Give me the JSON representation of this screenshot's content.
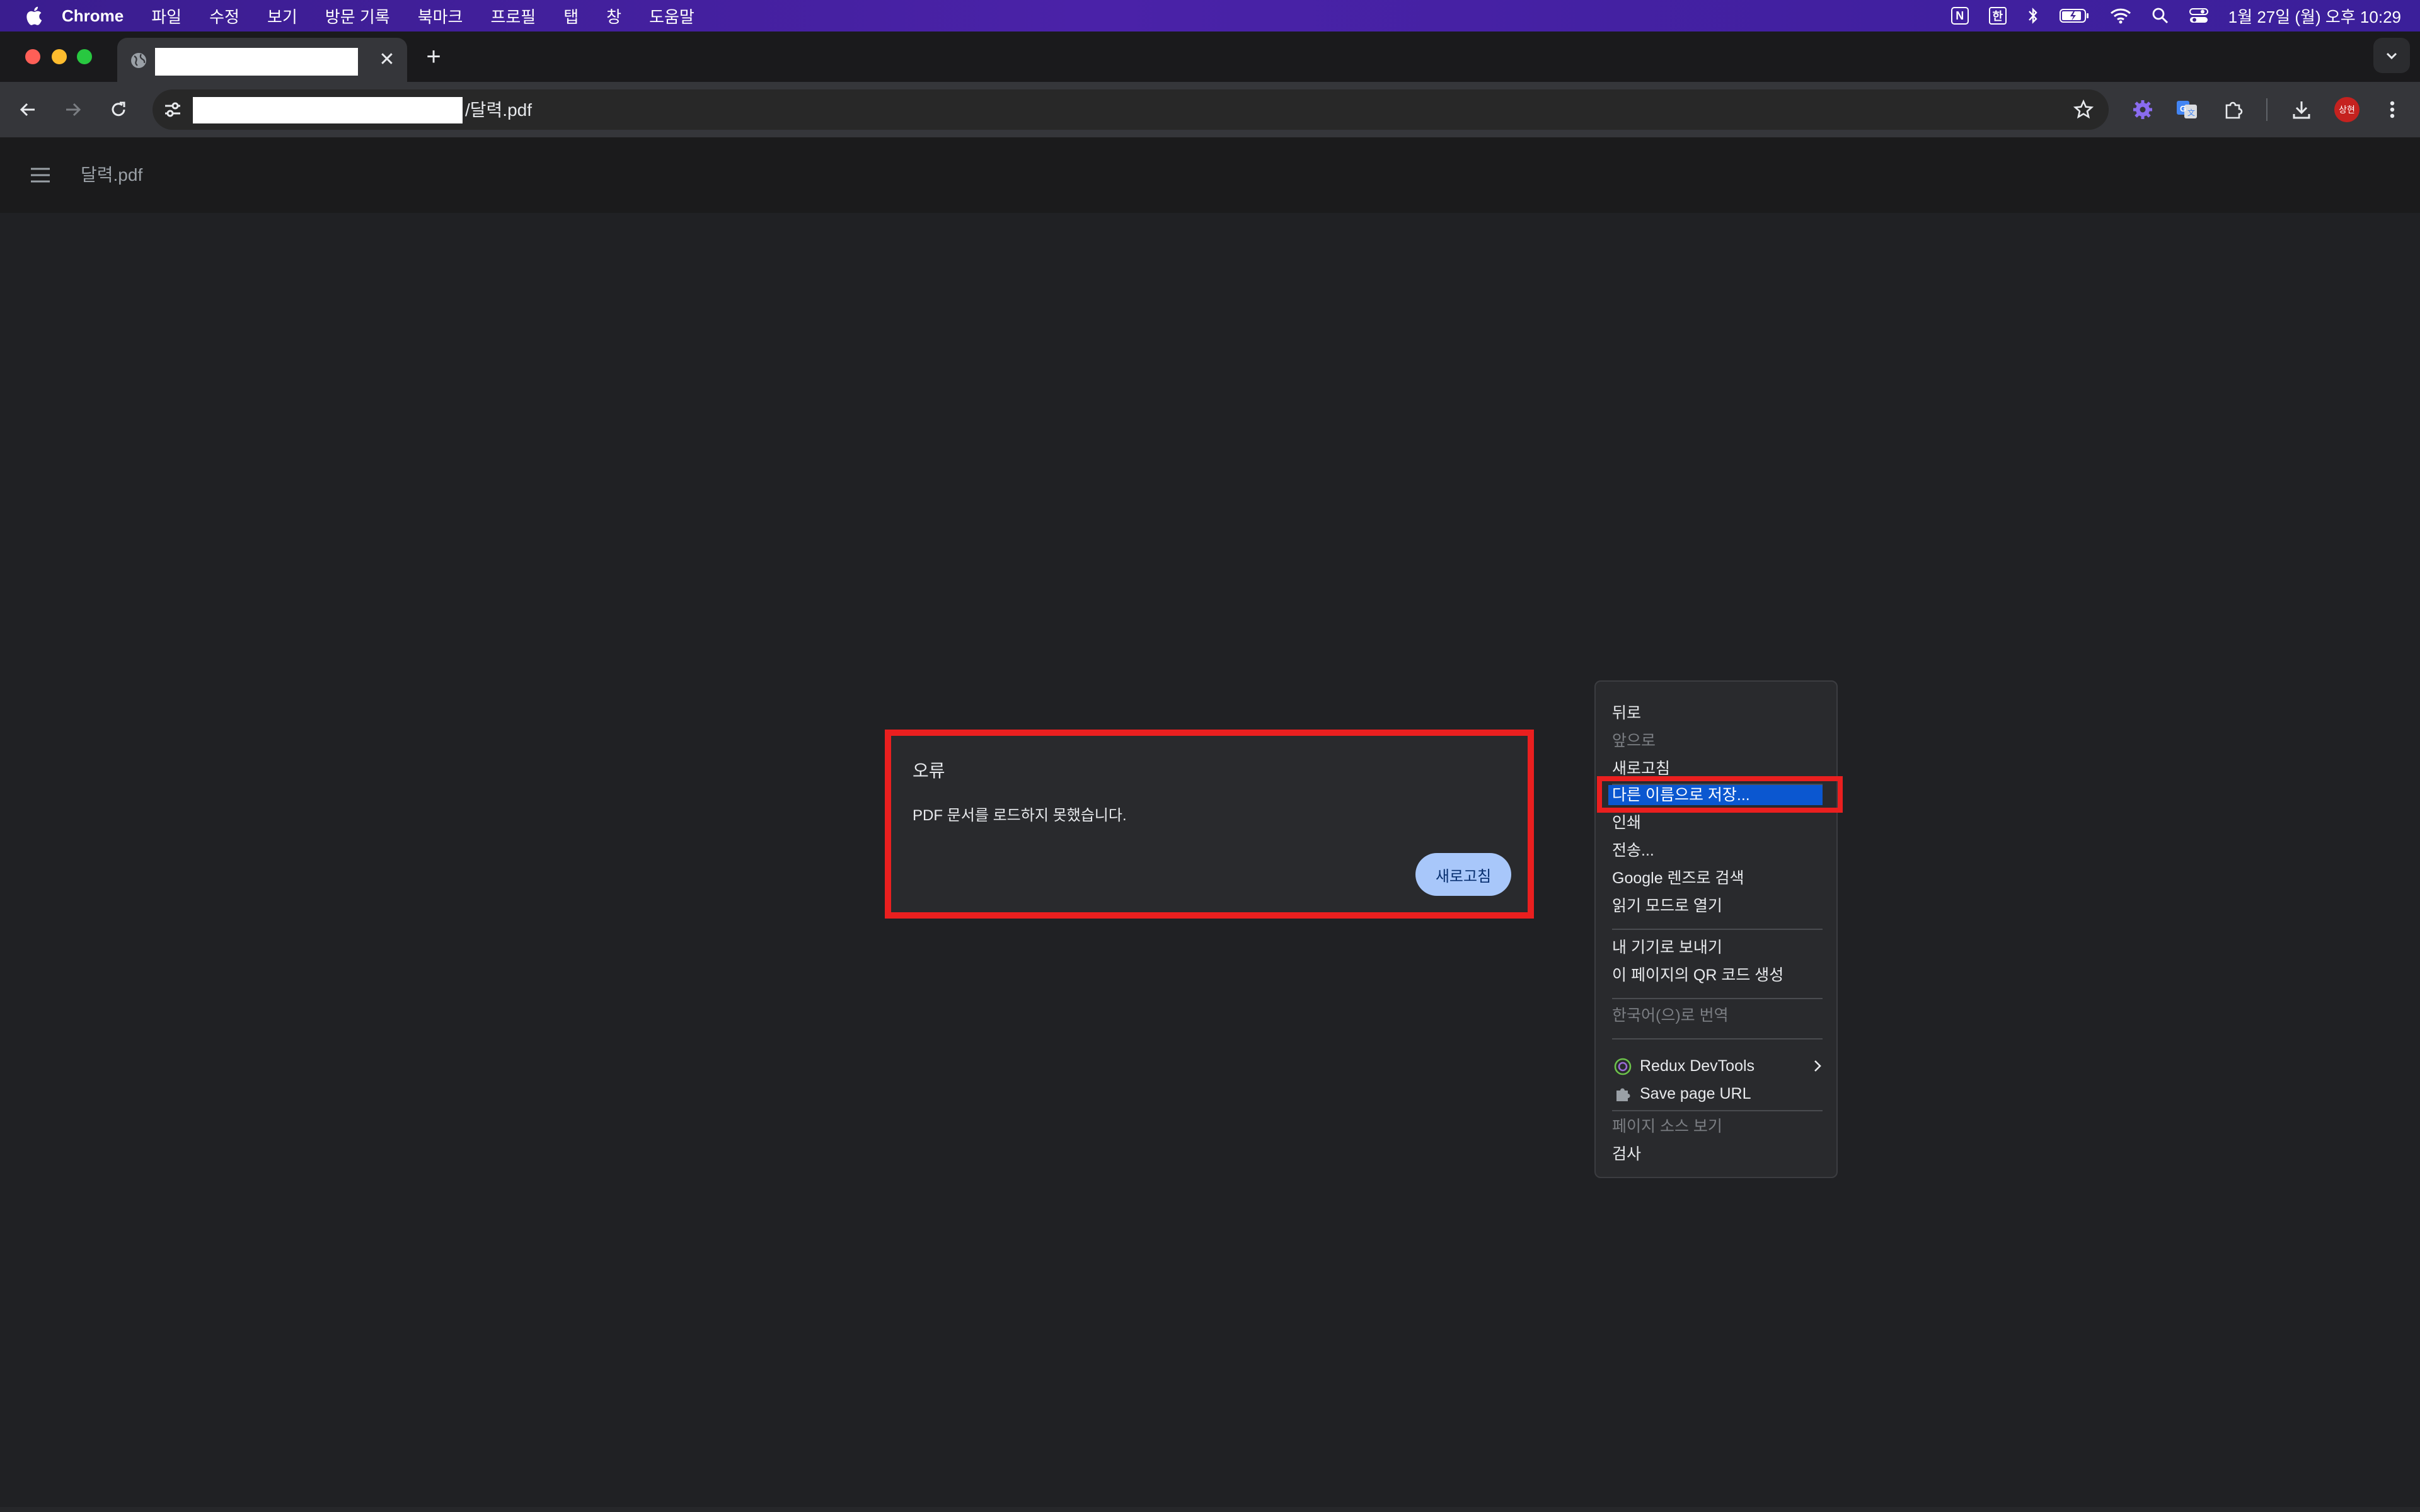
{
  "menubar": {
    "app": "Chrome",
    "items": [
      "파일",
      "수정",
      "보기",
      "방문 기록",
      "북마크",
      "프로필",
      "탭",
      "창",
      "도움말"
    ],
    "notion_badge": "N",
    "input_badge": "한",
    "clock": "1월 27일 (월) 오후 10:29"
  },
  "tab": {
    "close_label": "✕",
    "new_tab_label": "+"
  },
  "toolbar": {
    "url_suffix": "/달력.pdf",
    "profile_initials": "상현"
  },
  "pdf_viewer": {
    "title": "달력.pdf"
  },
  "error_dialog": {
    "title": "오류",
    "message": "PDF 문서를 로드하지 못했습니다.",
    "reload_label": "새로고침"
  },
  "context_menu": {
    "back": "뒤로",
    "forward": "앞으로",
    "reload": "새로고침",
    "save_as": "다른 이름으로 저장...",
    "print": "인쇄",
    "cast": "전송...",
    "search_lens": "Google 렌즈로 검색",
    "reading_mode": "읽기 모드로 열기",
    "send_to_devices": "내 기기로 보내기",
    "qr_code": "이 페이지의 QR 코드 생성",
    "translate": "한국어(으)로 번역",
    "redux_devtools": "Redux DevTools",
    "save_page_url": "Save page URL",
    "view_source": "페이지 소스 보기",
    "inspect": "검사"
  },
  "colors": {
    "accent_blue": "#0b57d0",
    "reload_button": "#a8c7fa",
    "annotation_red": "#ea1f1f",
    "background": "#202124"
  }
}
